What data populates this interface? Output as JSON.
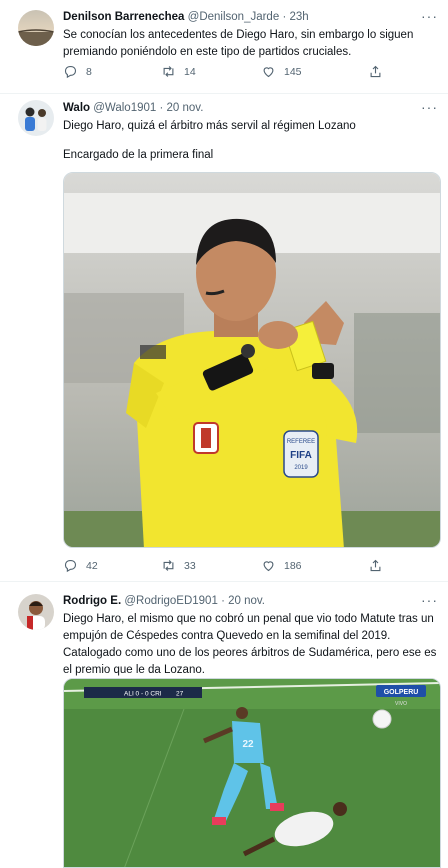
{
  "tweets": [
    {
      "name": "Denilson Barrenechea",
      "handle": "@Denilson_Jarde",
      "time": "23h",
      "text1": "Se conocían los antecedentes de Diego Haro, sin embargo lo siguen premiando poniéndolo en este tipo de partidos cruciales.",
      "replies": "8",
      "retweets": "14",
      "likes": "145"
    },
    {
      "name": "Walo",
      "handle": "@Walo1901",
      "time": "20 nov.",
      "text1": "Diego Haro, quizá el árbitro más servil al régimen Lozano",
      "text2": "Encargado de la primera final",
      "badge_ref": "REFEREE",
      "badge_fifa": "FIFA",
      "badge_year": "2019",
      "replies": "42",
      "retweets": "33",
      "likes": "186"
    },
    {
      "name": "Rodrigo E.",
      "handle": "@RodrigoED1901",
      "time": "20 nov.",
      "text1": "Diego Haro, el mismo que no cobró un penal que vio todo Matute tras un empujón de Céspedes contra Quevedo en la semifinal del 2019. Catalogado como uno de los peores árbitros de Sudamérica, pero ese es el premio que le da Lozano.",
      "score": "ALI 0 - 0 CRI",
      "clock": "27",
      "broadcaster": "GOLPERU",
      "live": "VIVO",
      "jersey": "22"
    }
  ],
  "separator": "·",
  "more": "···",
  "colors": {
    "link": "#1d9bf0",
    "muted": "#536471",
    "border": "#eff3f4"
  },
  "icons": [
    "reply-icon",
    "retweet-icon",
    "like-icon",
    "share-icon",
    "more-icon"
  ]
}
